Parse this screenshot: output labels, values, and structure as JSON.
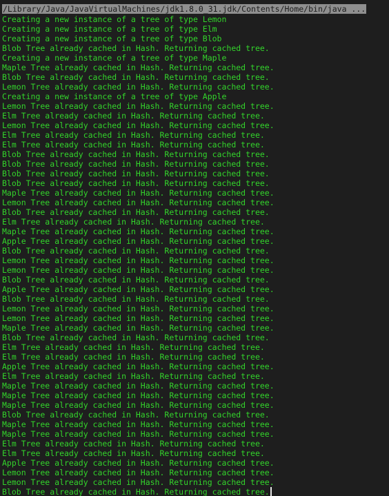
{
  "terminal": {
    "command": "/Library/Java/JavaVirtualMachines/jdk1.8.0_31.jdk/Contents/Home/bin/java ...",
    "colors": {
      "background": "#1e1e1e",
      "output_text": "#33d52b",
      "command_highlight": "#8f8f8f",
      "cursor": "#e6e6e6"
    },
    "lines": [
      "Creating a new instance of a tree of type Lemon",
      "Creating a new instance of a tree of type Elm",
      "Creating a new instance of a tree of type Blob",
      "Blob Tree already cached in Hash. Returning cached tree.",
      "Creating a new instance of a tree of type Maple",
      "Maple Tree already cached in Hash. Returning cached tree.",
      "Blob Tree already cached in Hash. Returning cached tree.",
      "Lemon Tree already cached in Hash. Returning cached tree.",
      "Creating a new instance of a tree of type Apple",
      "Lemon Tree already cached in Hash. Returning cached tree.",
      "Elm Tree already cached in Hash. Returning cached tree.",
      "Lemon Tree already cached in Hash. Returning cached tree.",
      "Elm Tree already cached in Hash. Returning cached tree.",
      "Elm Tree already cached in Hash. Returning cached tree.",
      "Blob Tree already cached in Hash. Returning cached tree.",
      "Blob Tree already cached in Hash. Returning cached tree.",
      "Blob Tree already cached in Hash. Returning cached tree.",
      "Blob Tree already cached in Hash. Returning cached tree.",
      "Maple Tree already cached in Hash. Returning cached tree.",
      "Lemon Tree already cached in Hash. Returning cached tree.",
      "Blob Tree already cached in Hash. Returning cached tree.",
      "Elm Tree already cached in Hash. Returning cached tree.",
      "Maple Tree already cached in Hash. Returning cached tree.",
      "Apple Tree already cached in Hash. Returning cached tree.",
      "Blob Tree already cached in Hash. Returning cached tree.",
      "Lemon Tree already cached in Hash. Returning cached tree.",
      "Lemon Tree already cached in Hash. Returning cached tree.",
      "Blob Tree already cached in Hash. Returning cached tree.",
      "Apple Tree already cached in Hash. Returning cached tree.",
      "Blob Tree already cached in Hash. Returning cached tree.",
      "Lemon Tree already cached in Hash. Returning cached tree.",
      "Lemon Tree already cached in Hash. Returning cached tree.",
      "Maple Tree already cached in Hash. Returning cached tree.",
      "Blob Tree already cached in Hash. Returning cached tree.",
      "Elm Tree already cached in Hash. Returning cached tree.",
      "Elm Tree already cached in Hash. Returning cached tree.",
      "Apple Tree already cached in Hash. Returning cached tree.",
      "Elm Tree already cached in Hash. Returning cached tree.",
      "Maple Tree already cached in Hash. Returning cached tree.",
      "Maple Tree already cached in Hash. Returning cached tree.",
      "Maple Tree already cached in Hash. Returning cached tree.",
      "Blob Tree already cached in Hash. Returning cached tree.",
      "Maple Tree already cached in Hash. Returning cached tree.",
      "Maple Tree already cached in Hash. Returning cached tree.",
      "Elm Tree already cached in Hash. Returning cached tree.",
      "Elm Tree already cached in Hash. Returning cached tree.",
      "Apple Tree already cached in Hash. Returning cached tree.",
      "Lemon Tree already cached in Hash. Returning cached tree.",
      "Lemon Tree already cached in Hash. Returning cached tree.",
      "Blob Tree already cached in Hash. Returning cached tree."
    ]
  }
}
